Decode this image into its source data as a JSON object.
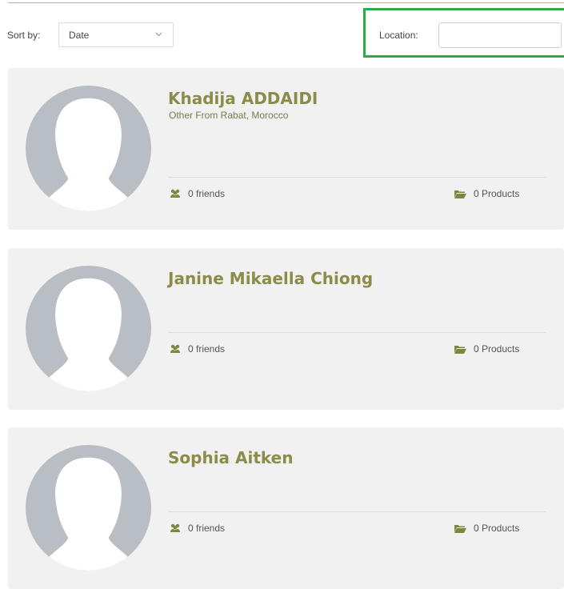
{
  "filters": {
    "sort_label": "Sort by:",
    "sort_value": "Date",
    "location_label": "Location:",
    "location_value": ""
  },
  "members": [
    {
      "name": "Khadija ADDAIDI",
      "subtitle": "Other From Rabat, Morocco",
      "friends": "0 friends",
      "products": "0 Products"
    },
    {
      "name": "Janine Mikaella Chiong",
      "subtitle": "",
      "friends": "0 friends",
      "products": "0 Products"
    },
    {
      "name": "Sophia Aitken",
      "subtitle": "",
      "friends": "0 friends",
      "products": "0 Products"
    }
  ],
  "icons": {
    "avatar": "default-avatar-icon",
    "friends": "users-icon",
    "products": "folder-icon",
    "sort": "chevron-down-icon"
  },
  "colors": {
    "accent": "#8c8c4a",
    "highlight": "#2fa84a",
    "card_bg": "#f1f1f1",
    "avatar": "#b8bec4",
    "icon": "#7a8a3c"
  }
}
